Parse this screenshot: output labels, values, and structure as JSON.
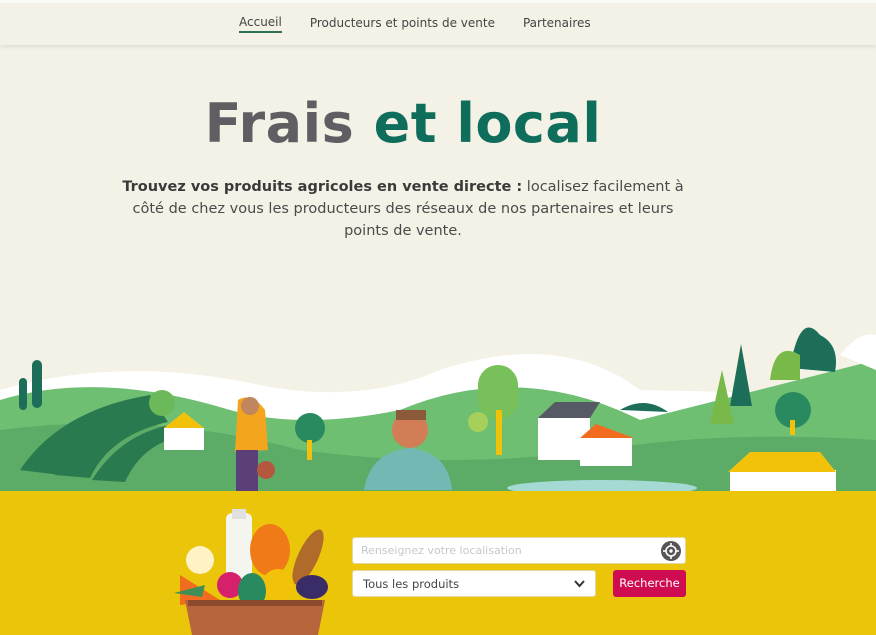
{
  "nav": {
    "items": [
      {
        "label": "Accueil",
        "active": true
      },
      {
        "label": "Producteurs et points de vente"
      },
      {
        "label": "Partenaires"
      }
    ]
  },
  "hero": {
    "title_part1": "Frais",
    "title_part2": "et local",
    "desc_bold": "Trouvez vos produits agricoles en vente directe :",
    "desc_rest": " localisez facilement à côté de chez vous les producteurs des réseaux de nos partenaires et leurs points de vente."
  },
  "search": {
    "location_placeholder": "Renseignez votre localisation",
    "products_selected": "Tous les produits",
    "button_label": "Recherche"
  },
  "colors": {
    "brand_green": "#0e6d5b",
    "title_grey": "#605e63",
    "yellow_band": "#eac50a",
    "cta_pink": "#cf0b52",
    "background": "#f4f2e6"
  },
  "icons": [
    "target-location-icon",
    "chevron-down-icon",
    "food-basket-illustration",
    "farm-landscape-illustration"
  ]
}
